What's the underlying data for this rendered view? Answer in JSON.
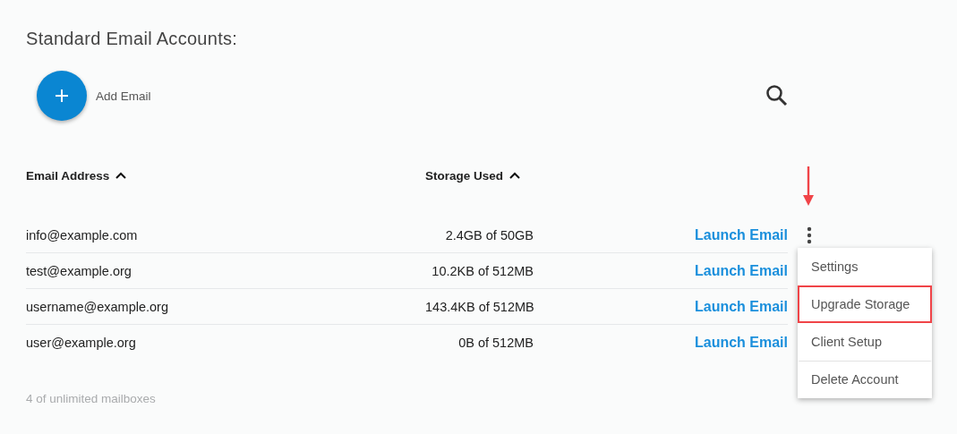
{
  "title": "Standard Email Accounts:",
  "add_button": {
    "label": "Add Email"
  },
  "columns": [
    {
      "label": "Email Address",
      "sort_ascending": true
    },
    {
      "label": "Storage Used",
      "sort_ascending": true
    }
  ],
  "rows": [
    {
      "email": "info@example.com",
      "storage": "2.4GB of 50GB",
      "action": "Launch Email",
      "menu_open": true
    },
    {
      "email": "test@example.org",
      "storage": "10.2KB of 512MB",
      "action": "Launch Email",
      "menu_open": false
    },
    {
      "email": "username@example.org",
      "storage": "143.4KB of 512MB",
      "action": "Launch Email",
      "menu_open": false
    },
    {
      "email": "user@example.org",
      "storage": "0B of 512MB",
      "action": "Launch Email",
      "menu_open": false
    }
  ],
  "footer": "4 of unlimited mailboxes",
  "menu": {
    "items": [
      {
        "label": "Settings",
        "highlighted": false,
        "divider_before": false
      },
      {
        "label": "Upgrade Storage",
        "highlighted": true,
        "divider_before": false
      },
      {
        "label": "Client Setup",
        "highlighted": false,
        "divider_before": false
      },
      {
        "label": "Delete Account",
        "highlighted": false,
        "divider_before": true
      }
    ]
  }
}
